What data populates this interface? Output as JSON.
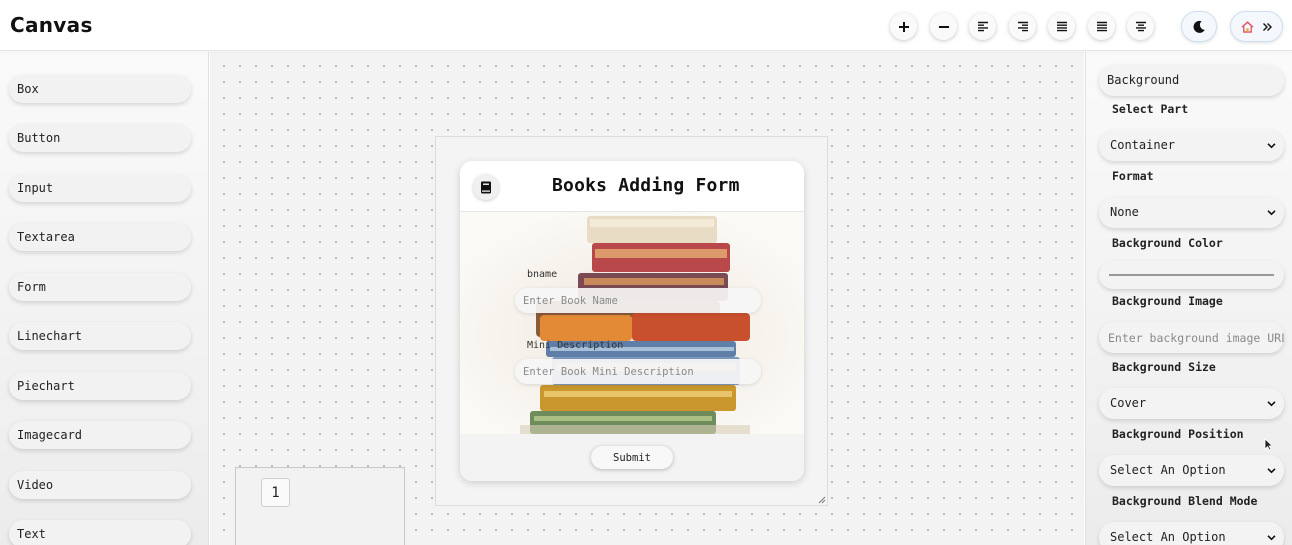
{
  "app": {
    "title": "Canvas"
  },
  "toolbar": {
    "buttons": [
      {
        "name": "zoom-in-button",
        "icon": "plus-icon"
      },
      {
        "name": "zoom-out-button",
        "icon": "minus-icon"
      },
      {
        "name": "align-left-button",
        "icon": "align-left-icon"
      },
      {
        "name": "align-right-button",
        "icon": "align-right-icon"
      },
      {
        "name": "align-justify-button",
        "icon": "align-justify-icon"
      },
      {
        "name": "align-justify-alt-button",
        "icon": "align-justify-icon"
      },
      {
        "name": "align-center-button",
        "icon": "align-center-icon"
      }
    ],
    "theme_icon": "moon-icon",
    "nav_icons": [
      "home-icon",
      "double-chevron-right-icon"
    ]
  },
  "components": [
    "Box",
    "Button",
    "Input",
    "Textarea",
    "Form",
    "Linechart",
    "Piechart",
    "Imagecard",
    "Video",
    "Text"
  ],
  "form_preview": {
    "icon": "book-icon",
    "title": "Books Adding Form",
    "fields": [
      {
        "label": "bname",
        "placeholder": "Enter Book Name"
      },
      {
        "label": "Mini Description",
        "placeholder": "Enter Book Mini Description"
      }
    ],
    "submit_label": "Submit"
  },
  "page_badge": "1",
  "properties": {
    "section_title": "Background",
    "select_part_label": "Select Part",
    "select_part_value": "Container",
    "format_label": "Format",
    "format_value": "None",
    "bg_color_label": "Background Color",
    "bg_image_label": "Background Image",
    "bg_image_placeholder": "Enter background image URL",
    "bg_size_label": "Background Size",
    "bg_size_value": "Cover",
    "bg_position_label": "Background Position",
    "bg_position_value": "Select An Option",
    "bg_blend_label": "Background Blend Mode",
    "bg_blend_value": "Select An Option"
  },
  "colors": {
    "accent_blue": "#cfe0f0",
    "home_icon": "#e05a6a",
    "canvas_bg": "#f3f3f3",
    "panel_bg": "#f3f3f3"
  }
}
